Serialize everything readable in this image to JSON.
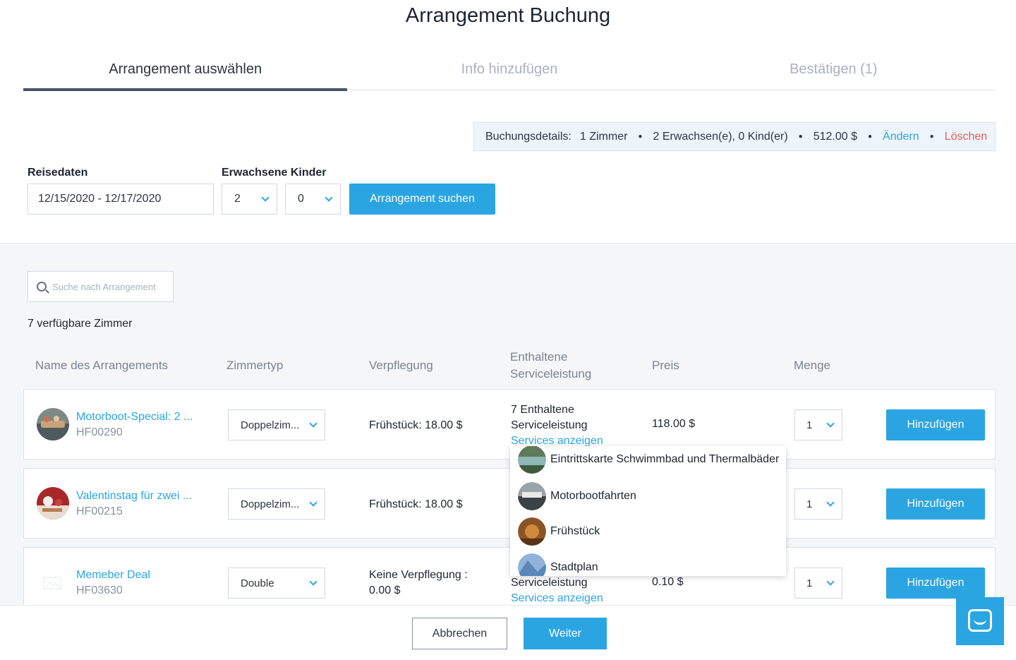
{
  "page": {
    "title": "Arrangement Buchung"
  },
  "tabs": [
    {
      "label": "Arrangement auswählen",
      "active": true
    },
    {
      "label": "Info hinzufügen",
      "active": false
    },
    {
      "label": "Bestätigen (1)",
      "active": false
    }
  ],
  "booking_details": {
    "label": "Buchungsdetails:",
    "rooms": "1 Zimmer",
    "guests": "2 Erwachsen(e), 0 Kind(er)",
    "total": "512.00 $",
    "change_label": "Ändern",
    "delete_label": "Löschen"
  },
  "search_form": {
    "dates_label": "Reisedaten",
    "dates_value": "12/15/2020 - 12/17/2020",
    "guests_label": "Erwachsene Kinder",
    "adults_value": "2",
    "children_value": "0",
    "search_button": "Arrangement suchen"
  },
  "list": {
    "search_placeholder": "Suche nach Arrangement",
    "room_count": "7 verfügbare Zimmer",
    "columns": {
      "name": "Name des Arrangements",
      "room_type": "Zimmertyp",
      "meals": "Verpflegung",
      "services_line1": "Enthaltene",
      "services_line2": "Serviceleistung",
      "price": "Preis",
      "quantity": "Menge"
    },
    "rows": [
      {
        "name": "Motorboot-Special: 2 ...",
        "code": "HF00290",
        "room_type": "Doppelzim...",
        "meal": "Frühstück: 18.00 $",
        "meal_line2": "",
        "services_line1": "7 Enthaltene",
        "services_line2": "Serviceleistung",
        "services_link": "Services anzeigen",
        "price": "118.00 $",
        "quantity": "1",
        "add_button": "Hinzufügen"
      },
      {
        "name": "Valentinstag für zwei ...",
        "code": "HF00215",
        "room_type": "Doppelzim...",
        "meal": "Frühstück: 18.00 $",
        "meal_line2": "",
        "services_line1": "",
        "services_line2": "",
        "services_link": "",
        "price": "",
        "quantity": "1",
        "add_button": "Hinzufügen"
      },
      {
        "name": "Memeber Deal",
        "code": "HF03630",
        "room_type": "Double",
        "meal": "Keine Verpflegung :",
        "meal_line2": "0.00 $",
        "services_line1": "",
        "services_line2": "Serviceleistung",
        "services_link": "Services anzeigen",
        "price": "0.10 $",
        "quantity": "1",
        "add_button": "Hinzufügen"
      }
    ]
  },
  "services_dropdown": [
    {
      "label": "Eintrittskarte Schwimmbad und Thermalbäder",
      "thumb": "pool-photo"
    },
    {
      "label": "Motorbootfahrten",
      "thumb": "boat-photo"
    },
    {
      "label": "Frühstück",
      "thumb": "breakfast-photo"
    },
    {
      "label": "Stadtplan",
      "thumb": "city-map-photo"
    }
  ],
  "footer": {
    "cancel_label": "Abbrechen",
    "next_label": "Weiter"
  },
  "colors": {
    "accent": "#2aa5e2",
    "danger": "#ea5b55",
    "tab_indicator": "#475466"
  }
}
